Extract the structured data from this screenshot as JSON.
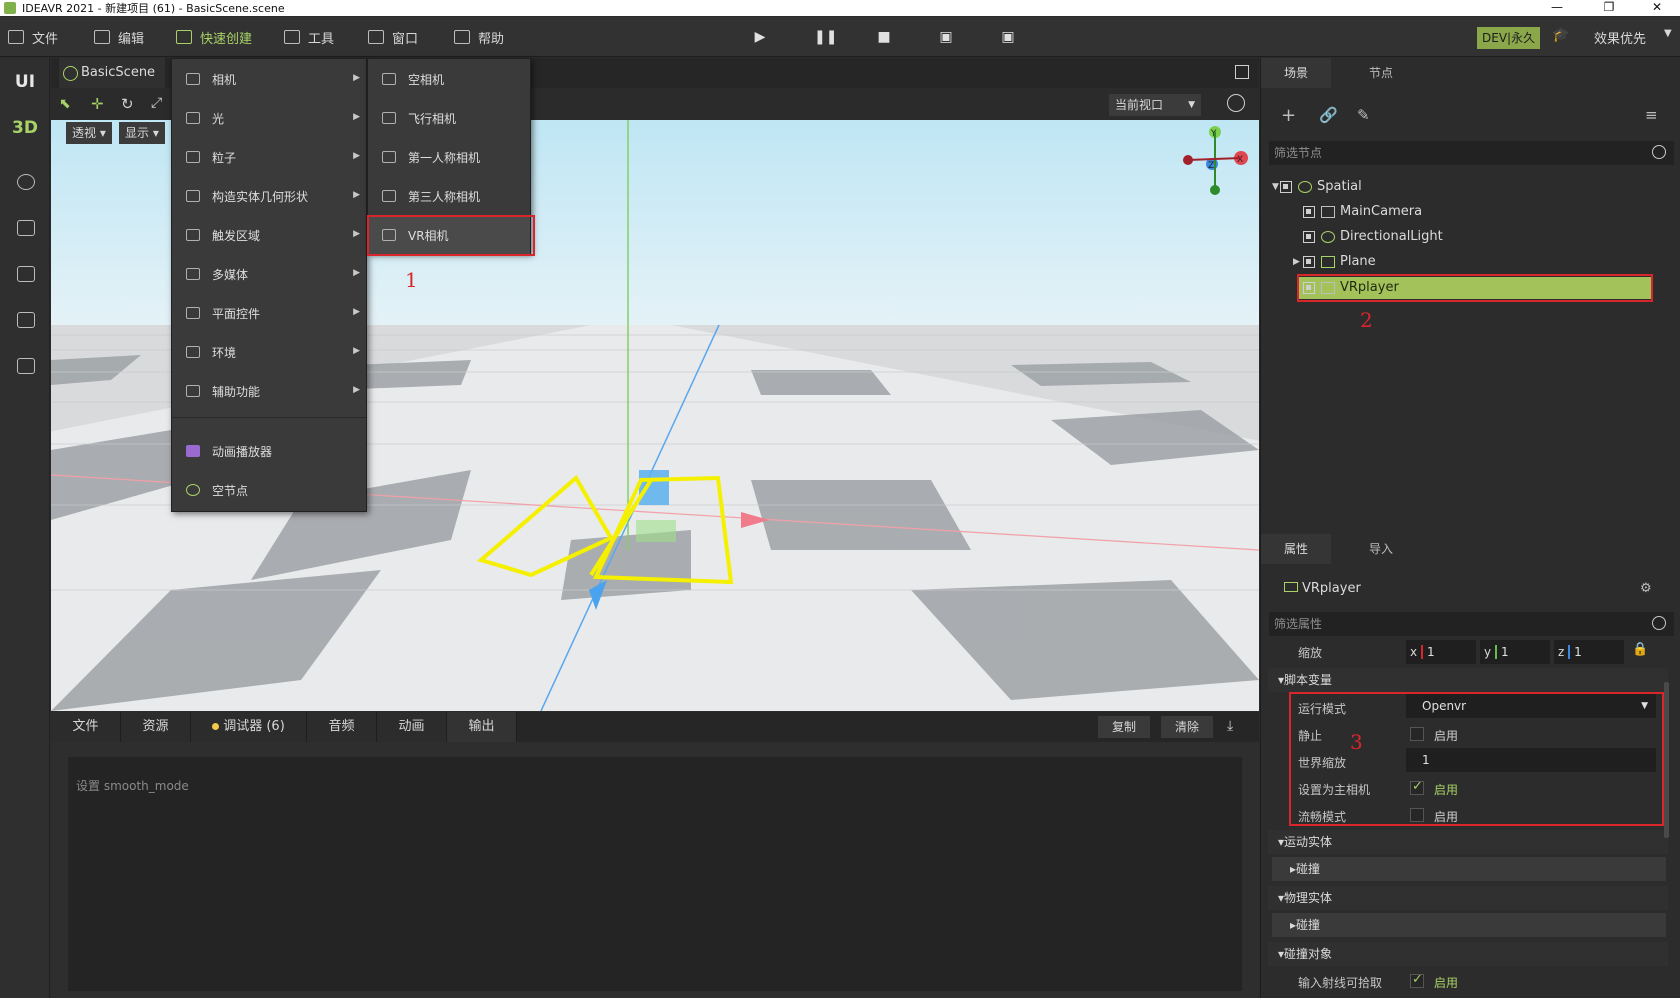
{
  "window": {
    "title": "IDEAVR 2021 - 新建项目 (61) - BasicScene.scene",
    "controls": [
      "—",
      "❐",
      "✕"
    ]
  },
  "menubar": {
    "items": [
      "文件",
      "编辑",
      "快速创建",
      "工具",
      "窗口",
      "帮助"
    ],
    "active": "快速创建",
    "badge": "DEV|永久",
    "quality": "效果优先"
  },
  "lefttb": {
    "ui": "UI",
    "d3": "3D"
  },
  "scene_tab": "BasicScene",
  "viewport": {
    "perspective": "透视",
    "display": "显示",
    "current_view": "当前视口",
    "axis_labels": {
      "x": "X",
      "y": "Y",
      "z": "Z"
    }
  },
  "quick_create": {
    "items": [
      {
        "label": "相机",
        "submenu": true
      },
      {
        "label": "光",
        "submenu": true
      },
      {
        "label": "粒子",
        "submenu": true
      },
      {
        "label": "构造实体几何形状",
        "submenu": true
      },
      {
        "label": "触发区域",
        "submenu": true
      },
      {
        "label": "多媒体",
        "submenu": true
      },
      {
        "label": "平面控件",
        "submenu": true
      },
      {
        "label": "环境",
        "submenu": true
      },
      {
        "label": "辅助功能",
        "submenu": true
      },
      {
        "label": "动画播放器",
        "submenu": false
      },
      {
        "label": "空节点",
        "submenu": false
      }
    ],
    "camera_submenu": [
      "空相机",
      "飞行相机",
      "第一人称相机",
      "第三人称相机",
      "VR相机"
    ]
  },
  "bottom": {
    "tabs": [
      "文件",
      "资源",
      "调试器 (6)",
      "音频",
      "动画",
      "输出"
    ],
    "active_tab": "输出",
    "copy": "复制",
    "clear": "清除",
    "output_text": "设置 smooth_mode"
  },
  "scene_panel": {
    "tabs": [
      "场景",
      "节点"
    ],
    "filter_placeholder": "筛选节点",
    "nodes": [
      "Spatial",
      "MainCamera",
      "DirectionalLight",
      "Plane",
      "VRplayer"
    ],
    "selected": "VRplayer"
  },
  "props_panel": {
    "tabs": [
      "属性",
      "导入"
    ],
    "node_name": "VRplayer",
    "filter_placeholder": "筛选属性",
    "scale_label": "缩放",
    "scale": {
      "x": "1",
      "y": "1",
      "z": "1"
    },
    "section_script": "脚本变量",
    "run_mode_label": "运行模式",
    "run_mode_value": "Openvr",
    "static_label": "静止",
    "world_scale_label": "世界缩放",
    "world_scale_value": "1",
    "main_camera_label": "设置为主相机",
    "smooth_label": "流畅模式",
    "enable": "启用",
    "section_motion": "运动实体",
    "section_physics": "物理实体",
    "collision": "碰撞",
    "section_collision_obj": "碰撞对象",
    "ray_pick_label": "输入射线可拾取"
  },
  "annotations": [
    "1",
    "2",
    "3"
  ],
  "colors": {
    "accent": "#a8d267",
    "selected": "#a3c25a",
    "annotation": "#d9262c"
  }
}
